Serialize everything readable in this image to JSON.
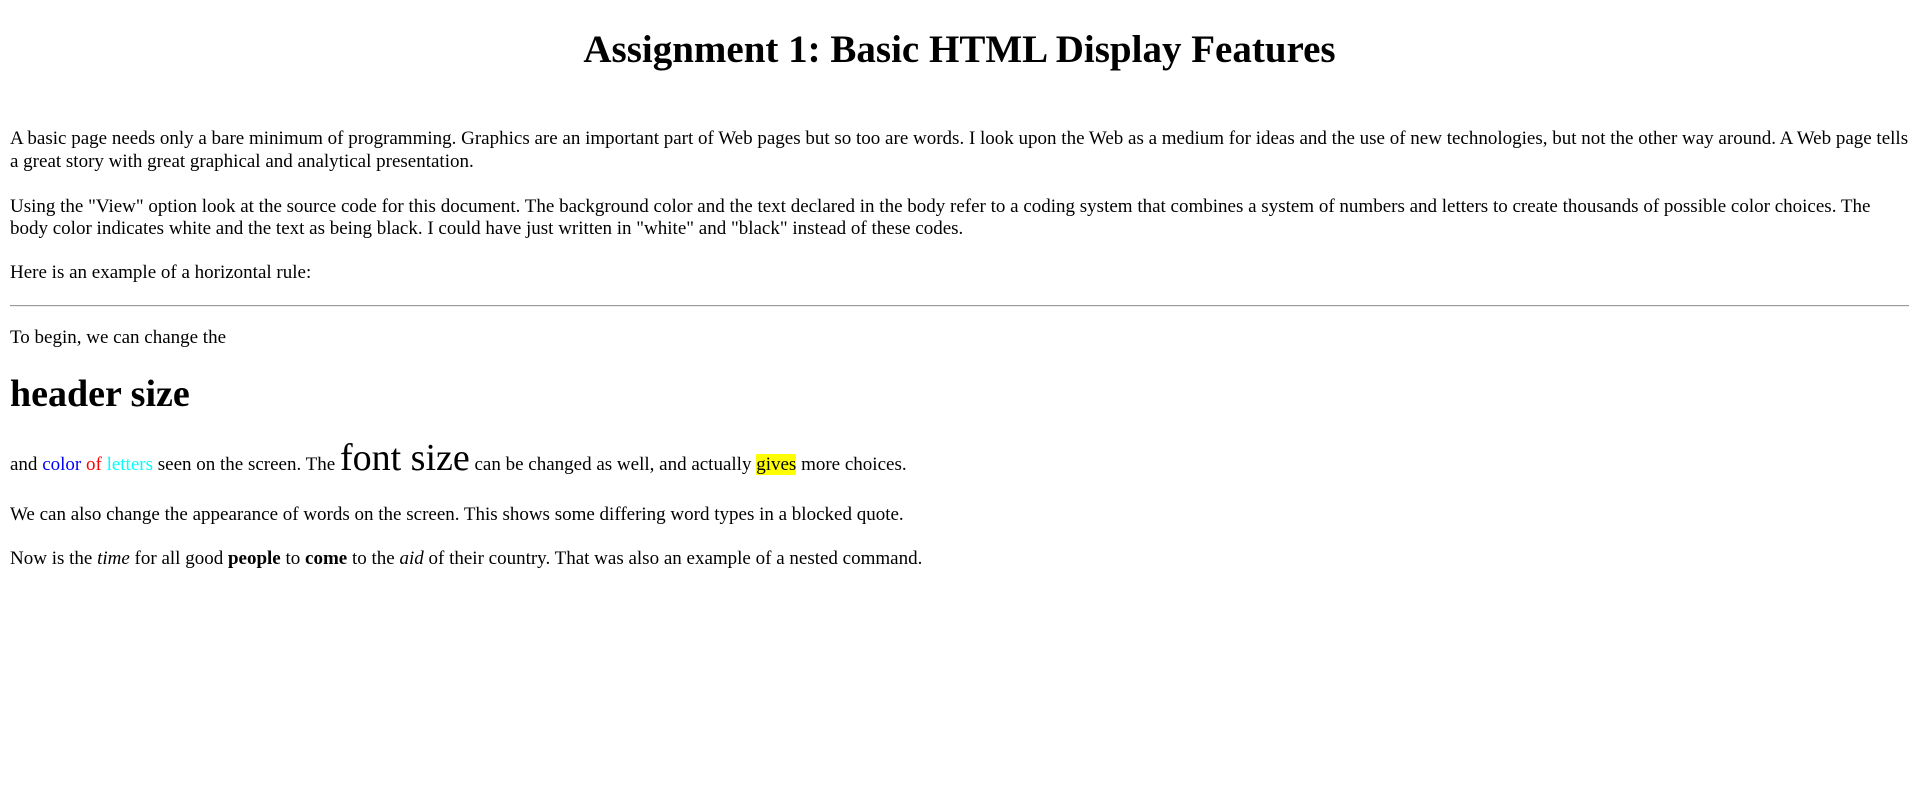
{
  "page": {
    "title": "Assignment 1: Basic HTML Display Features",
    "paragraph1": "A basic page needs only a bare minimum of programming. Graphics are an important part of Web pages but so too are words. I look upon the Web as a medium for ideas and the use of new technologies, but not the other way around. A Web page tells a great story with great graphical and analytical presentation.",
    "paragraph2": "Using the \"View\" option look at the source code for this document. The background color and the text declared in the body refer to a coding system that combines a system of numbers and letters to create thousands of possible color choices. The body color indicates white and the text as being black. I could have just written in \"white\" and \"black\" instead of these codes.",
    "paragraph3": "Here is an example of a horizontal rule:",
    "paragraph4": "To begin, we can change the",
    "header_size": "header size",
    "line5": {
      "and": "and ",
      "color": "color",
      "of": "of",
      "letters": "letters",
      "seen": " seen on the screen. The ",
      "font_size": "font size",
      "changed": " can be changed as well, and actually ",
      "gives": "gives",
      "more": " more choices."
    },
    "paragraph6": "We can also change the appearance of words on the screen. This shows some differing word types in a blocked quote.",
    "line7": {
      "now": "Now is the ",
      "time": "time",
      "for_all": " for all good ",
      "people": "people",
      "to": " to ",
      "come": "come",
      "to_the": " to the ",
      "aid": "aid",
      "rest": " of their country. That was also an example of a nested command."
    }
  },
  "colors": {
    "background": "#ffffff",
    "text": "#000000",
    "color_word": "#0000ff",
    "of_word": "#ff0000",
    "letters_word": "#00ffff",
    "highlight": "#ffff00"
  }
}
